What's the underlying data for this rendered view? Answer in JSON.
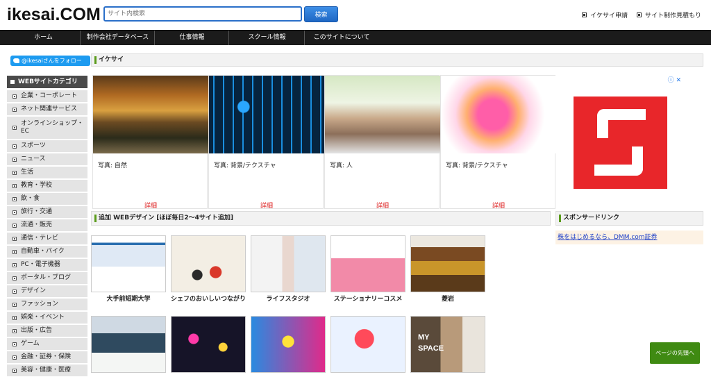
{
  "header": {
    "logo": "ikesai.COM",
    "search_placeholder": "サイト内検索",
    "search_button": "検索",
    "link_apply": "イケサイ申請",
    "link_estimate": "サイト制作見積もり"
  },
  "nav": {
    "items": [
      "ホーム",
      "制作会社データベース",
      "仕事情報",
      "スクール情報",
      "このサイトについて"
    ]
  },
  "sidebar": {
    "twitter": "@ikesaiさんをフォロー",
    "category_header": "WEBサイトカテゴリ",
    "categories": [
      "企業・コーポレート",
      "ネット関連サービス",
      "オンラインショップ・EC",
      "スポーツ",
      "ニュース",
      "生活",
      "教育・学校",
      "飲・食",
      "旅行・交通",
      "流通・販売",
      "通信・テレビ",
      "自動車・バイク",
      "PC・電子機器",
      "ポータル・ブログ",
      "デザイン",
      "ファッション",
      "娯楽・イベント",
      "出版・広告",
      "ゲーム",
      "金融・証券・保険",
      "美容・健康・医療"
    ]
  },
  "main": {
    "section_ikesai": "イケサイ",
    "photos": [
      {
        "caption": "写真: 自然",
        "more": "詳細",
        "icon": "nature-photo"
      },
      {
        "caption": "写真: 背景/テクスチャ",
        "more": "詳細",
        "icon": "circuit-photo"
      },
      {
        "caption": "写真: 人",
        "more": "詳細",
        "icon": "people-photo"
      },
      {
        "caption": "写真: 背景/テクスチャ",
        "more": "詳細",
        "icon": "color-splash-photo"
      }
    ],
    "section_web": "追加 WEBデザイン [ほぼ毎日2〜4サイト追加]",
    "section_sponsor": "スポンサードリンク",
    "sponsor_link": "株をはじめるなら、DMM.com証券",
    "sites": [
      {
        "name": "大手前短期大学"
      },
      {
        "name": "シェフのおいしいつながり"
      },
      {
        "name": "ライフスタジオ"
      },
      {
        "name": "ステーショナリーコスメ"
      },
      {
        "name": "菱岩"
      }
    ],
    "site10_text": "MY\nSPACE"
  },
  "ad": {
    "info": "ⓘ ✕"
  },
  "page_top": "ページの先頭へ",
  "colors": {
    "nav_bg": "#1b1b1b",
    "accent_green": "#5a9b1a",
    "search_blue": "#2a6fc9",
    "link_red": "#d22222"
  }
}
